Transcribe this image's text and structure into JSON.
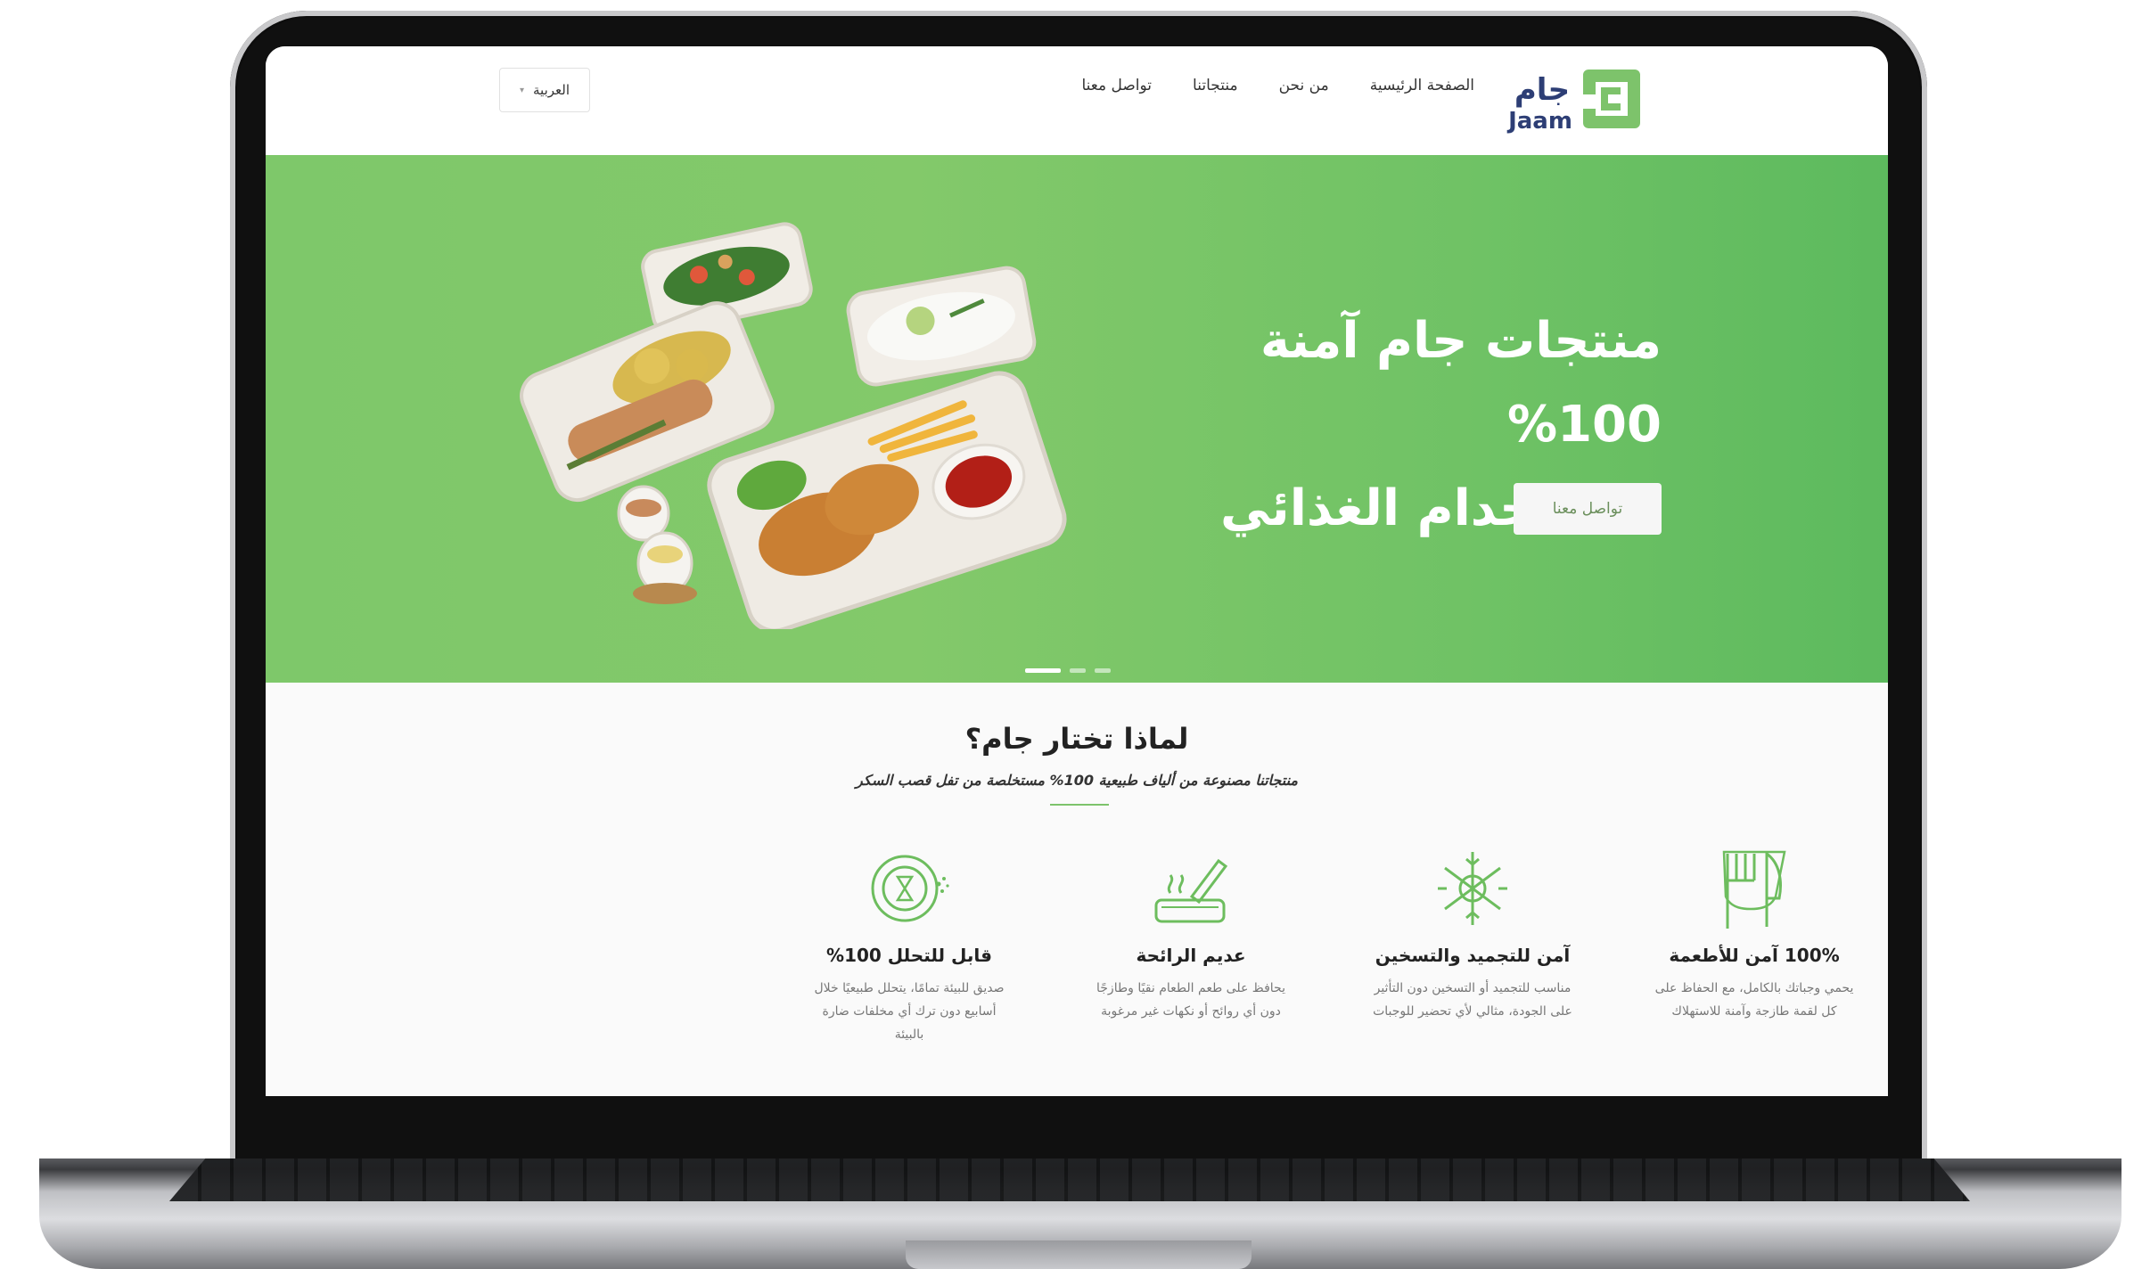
{
  "brand": {
    "name_ar": "جام",
    "name_en": "Jaam",
    "accent": "#7dc36b",
    "logo_text_color": "#2d3e75"
  },
  "nav": {
    "items": [
      {
        "label": "الصفحة الرئيسية"
      },
      {
        "label": "من نحن"
      },
      {
        "label": "منتجاتنا"
      },
      {
        "label": "تواصل معنا"
      }
    ],
    "language": "العربية"
  },
  "hero": {
    "title_line1": "منتجات جام آمنة 100%",
    "title_line2": "للاستخدام الغذائي",
    "button": "تواصل معنا",
    "slides": 3,
    "active_slide": 1
  },
  "why": {
    "title": "لماذا تختار جام؟",
    "subtitle": "منتجاتنا مصنوعة من ألياف طبيعية 100% مستخلصة من تفل قصب السكر",
    "features": [
      {
        "icon": "fork-knife-icon",
        "title": "100% آمن للأطعمة",
        "text": "يحمي وجباتك بالكامل، مع الحفاظ على كل لقمة طازجة وآمنة للاستهلاك"
      },
      {
        "icon": "snowflake-sun-icon",
        "title": "آمن للتجميد والتسخين",
        "text": "مناسب للتجميد أو التسخين دون التأثير على الجودة، مثالي لأي تحضير للوجبات"
      },
      {
        "icon": "odorless-tray-icon",
        "title": "عديم الرائحة",
        "text": "يحافظ على طعم الطعام نقيًا وطازجًا دون أي روائح أو نكهات غير مرغوبة"
      },
      {
        "icon": "biodegradable-icon",
        "title": "قابل للتحلل 100%",
        "text": "صديق للبيئة تمامًا، يتحلل طبيعيًا خلال أسابيع دون ترك أي مخلفات ضارة بالبيئة"
      }
    ]
  }
}
